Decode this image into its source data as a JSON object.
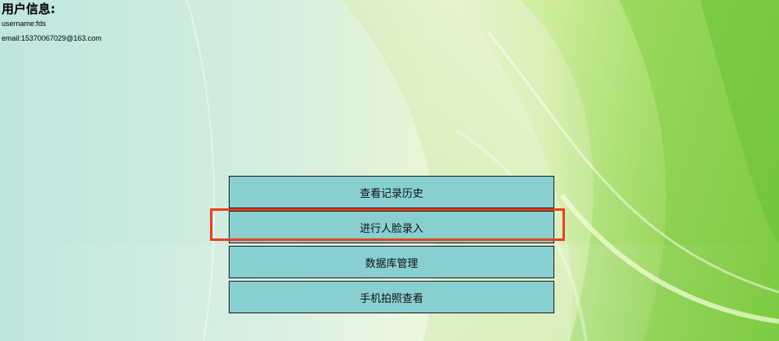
{
  "user_info": {
    "title": "用户信息:",
    "username": "username:fds",
    "email": "email:15370067029@163.com"
  },
  "menu": {
    "items": [
      {
        "label": "查看记录历史"
      },
      {
        "label": "进行人脸录入"
      },
      {
        "label": "数据库管理"
      },
      {
        "label": "手机拍照查看"
      }
    ]
  },
  "colors": {
    "button_bg": "#88cfd0",
    "highlight_border": "#e8411d",
    "bg_left": "#bfe6df",
    "bg_right": "#8fd24a"
  }
}
